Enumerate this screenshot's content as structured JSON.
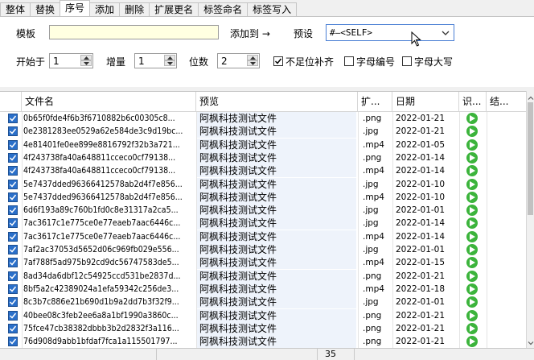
{
  "tabs": [
    {
      "label": "整体"
    },
    {
      "label": "替换"
    },
    {
      "label": "序号",
      "active": true
    },
    {
      "label": "添加"
    },
    {
      "label": "删除"
    },
    {
      "label": "扩展更名"
    },
    {
      "label": "标签命名"
    },
    {
      "label": "标签写入"
    }
  ],
  "form": {
    "template_label": "模板",
    "template_value": "",
    "add_to_label": "添加到 →",
    "preset_label": "预设",
    "preset_value": "#—<SELF>",
    "start_label": "开始于",
    "start_value": "1",
    "step_label": "增量",
    "step_value": "1",
    "digits_label": "位数",
    "digits_value": "2",
    "pad_label": "不足位补齐",
    "pad_checked": true,
    "letter_num_label": "字母编号",
    "letter_num_checked": false,
    "upper_label": "字母大写",
    "upper_checked": false
  },
  "table": {
    "columns": [
      "文件名",
      "预览",
      "扩...",
      "日期",
      "识...",
      "结..."
    ],
    "rows": [
      {
        "name": "0b65f0fde4f6b3f6710882b6c00305c8...",
        "preview": "阿枫科技测试文件",
        "ext": ".png",
        "date": "2022-01-21"
      },
      {
        "name": "0e2381283ee0529a62e584de3c9d19bc...",
        "preview": "阿枫科技测试文件",
        "ext": ".jpg",
        "date": "2022-01-21"
      },
      {
        "name": "4e81401fe0ee899e8816792f32b3a721...",
        "preview": "阿枫科技测试文件",
        "ext": ".mp4",
        "date": "2022-01-05"
      },
      {
        "name": "4f243738fa40a648811cceco0cf79138...",
        "preview": "阿枫科技测试文件",
        "ext": ".png",
        "date": "2022-01-14"
      },
      {
        "name": "4f243738fa40a648811cceco0cf79138...",
        "preview": "阿枫科技测试文件",
        "ext": ".mp4",
        "date": "2022-01-14"
      },
      {
        "name": "5e7437dded96366412578ab2d4f7e856...",
        "preview": "阿枫科技测试文件",
        "ext": ".jpg",
        "date": "2022-01-10"
      },
      {
        "name": "5e7437dded96366412578ab2d4f7e856...",
        "preview": "阿枫科技测试文件",
        "ext": ".mp4",
        "date": "2022-01-10"
      },
      {
        "name": "6d6f193a89c760b1fd0c8e31317a2ca5...",
        "preview": "阿枫科技测试文件",
        "ext": ".jpg",
        "date": "2022-01-01"
      },
      {
        "name": "7ac3617c1e775ce0e77eaeb7aac6446c...",
        "preview": "阿枫科技测试文件",
        "ext": ".jpg",
        "date": "2022-01-14"
      },
      {
        "name": "7ac3617c1e775ce0e77eaeb7aac6446c...",
        "preview": "阿枫科技测试文件",
        "ext": ".mp4",
        "date": "2022-01-14"
      },
      {
        "name": "7af2ac37053d5652d06c969fb029e556...",
        "preview": "阿枫科技测试文件",
        "ext": ".jpg",
        "date": "2022-01-01"
      },
      {
        "name": "7af788f5ad975b92cd9dc56747583de5...",
        "preview": "阿枫科技测试文件",
        "ext": ".mp4",
        "date": "2022-01-15"
      },
      {
        "name": "8ad34da6dbf12c54925ccd531be2837d...",
        "preview": "阿枫科技测试文件",
        "ext": ".png",
        "date": "2022-01-21"
      },
      {
        "name": "8bf5a2c42389024a1efa59342c256de3...",
        "preview": "阿枫科技测试文件",
        "ext": ".mp4",
        "date": "2022-01-18"
      },
      {
        "name": "8c3b7c886e21b690d1b9a2dd7b3f32f9...",
        "preview": "阿枫科技测试文件",
        "ext": ".jpg",
        "date": "2022-01-01"
      },
      {
        "name": "40bee08c3feb2ee6a8a1bf1990a3860c...",
        "preview": "阿枫科技测试文件",
        "ext": ".png",
        "date": "2022-01-21"
      },
      {
        "name": "75fce47cb38382dbbb3b2d2832f3a116...",
        "preview": "阿枫科技测试文件",
        "ext": ".png",
        "date": "2022-01-21"
      },
      {
        "name": "76d908d9abb1bfdaf7fca1a115501797...",
        "preview": "阿枫科技测试文件",
        "ext": ".png",
        "date": "2022-01-21"
      }
    ]
  },
  "status": {
    "count": "35"
  },
  "colors": {
    "template_bg": "#ffffe1",
    "preview_bg": "#eef3fb",
    "checkbox_blue": "#2a6fc9",
    "play_green": "#3cb43c"
  },
  "icons": {
    "arrow": "right-arrow-icon",
    "dropdown": "chevron-down-icon",
    "row_check": "checkmark-icon",
    "status_ok": "play-icon"
  }
}
